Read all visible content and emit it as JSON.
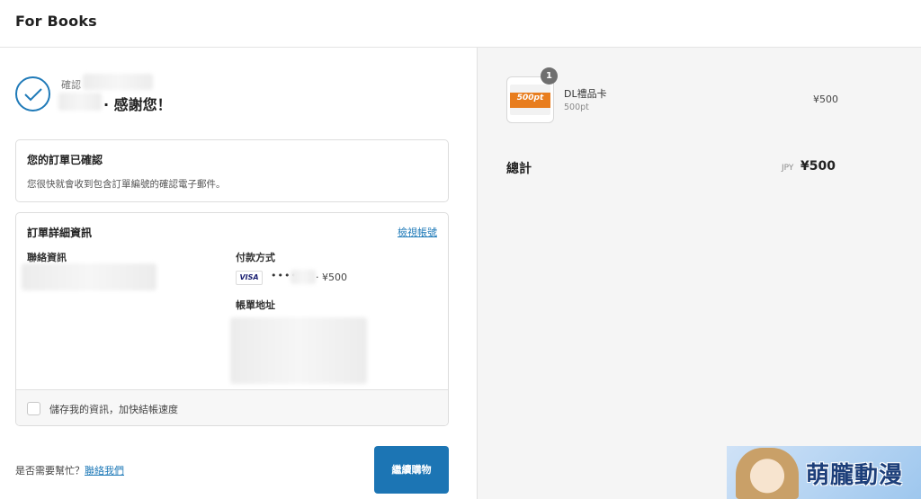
{
  "header": {
    "brand": "For Books"
  },
  "confirmation": {
    "small_label": "確認",
    "thanks": "· 感謝您！"
  },
  "order_confirmed": {
    "title": "您的訂單已確認",
    "description": "您很快就會收到包含訂單編號的確認電子郵件。"
  },
  "order_details": {
    "title": "訂單詳細資訊",
    "view_account_link": "檢視帳號",
    "contact_label": "聯絡資訊",
    "payment_label": "付款方式",
    "card_brand": "VISA",
    "card_dots": "••••",
    "card_amount": "· ¥500",
    "billing_label": "帳單地址",
    "save_info_label": "儲存我的資訊，加快結帳速度",
    "save_info_checked": false
  },
  "footer": {
    "help_text": "是否需要幫忙？",
    "contact_link": "聯絡我們",
    "continue_button": "繼續購物"
  },
  "summary": {
    "item": {
      "thumbnail_text": "500pt",
      "quantity": "1",
      "name": "DL禮品卡",
      "variant": "500pt",
      "price": "¥500"
    },
    "total_label": "總計",
    "currency": "JPY",
    "total_value": "¥500"
  },
  "watermark": {
    "text": "萌朧動漫"
  },
  "colors": {
    "accent": "#1c75b4",
    "link": "#1f7ab8",
    "orange": "#e87d1e"
  }
}
